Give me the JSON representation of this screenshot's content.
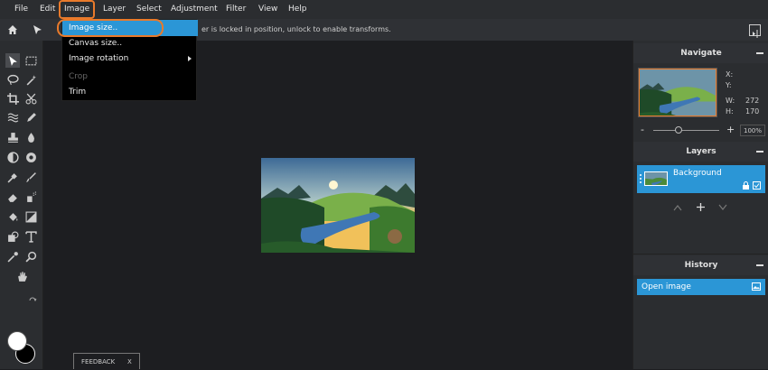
{
  "menubar": {
    "items": [
      "File",
      "Edit",
      "Image",
      "Layer",
      "Select",
      "Adjustment",
      "Filter",
      "View",
      "Help"
    ]
  },
  "topbar": {
    "message": "er is locked in position, unlock to enable transforms."
  },
  "image_menu": {
    "items": [
      {
        "label": "Image size..",
        "state": "selected"
      },
      {
        "label": "Canvas size..",
        "state": "normal"
      },
      {
        "label": "Image rotation",
        "state": "submenu"
      },
      {
        "label": "Crop",
        "state": "disabled"
      },
      {
        "label": "Trim",
        "state": "normal"
      }
    ]
  },
  "feedback": {
    "label": "FEEDBACK",
    "close": "X"
  },
  "navigate": {
    "title": "Navigate",
    "x_label": "X:",
    "y_label": "Y:",
    "w_label": "W:",
    "w_value": "272",
    "h_label": "H:",
    "h_value": "170",
    "zoom_minus": "-",
    "zoom_plus": "+",
    "zoom_value": "100%"
  },
  "layers": {
    "title": "Layers",
    "items": [
      {
        "name": "Background"
      }
    ]
  },
  "history": {
    "title": "History",
    "items": [
      {
        "label": "Open image"
      }
    ]
  },
  "colors": {
    "accent_blue": "#2b96d6",
    "highlight_orange": "#e97a2b"
  }
}
